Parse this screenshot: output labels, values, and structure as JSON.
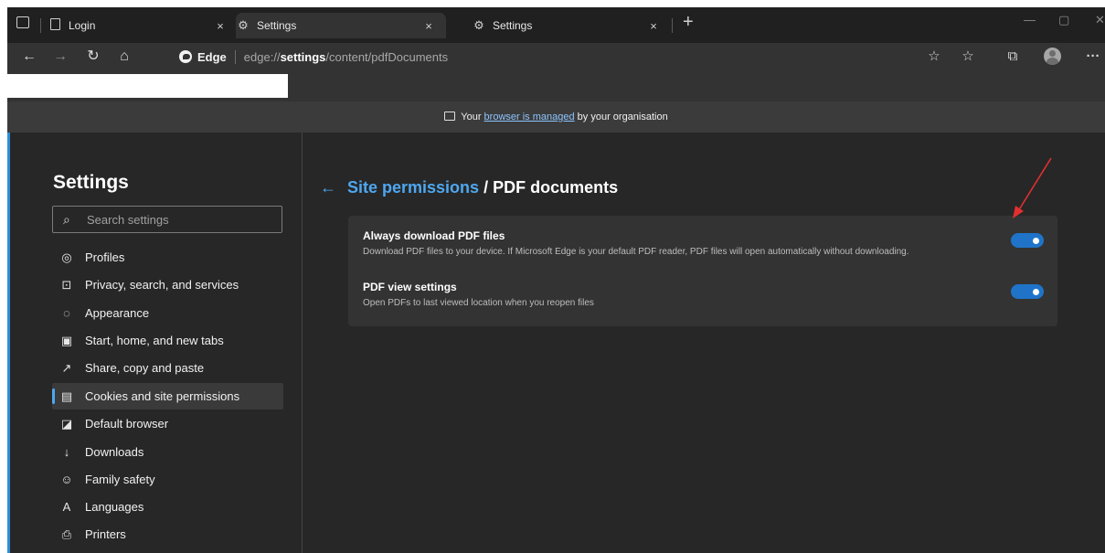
{
  "tabs": [
    {
      "title": "Login",
      "icon": "page-icon",
      "close": "×",
      "active": false
    },
    {
      "title": "Settings",
      "icon": "gear-icon",
      "close": "×",
      "active": true
    },
    {
      "title": "Settings",
      "icon": "gear-icon",
      "close": "×",
      "active": false
    }
  ],
  "new_tab": "+",
  "window_controls": {
    "minimize": "—",
    "maximize": "▢",
    "close": "✕"
  },
  "address_bar": {
    "brand": "Edge",
    "url_prefix": "edge://",
    "url_strong": "settings",
    "url_rest": "/content/pdfDocuments"
  },
  "managed_banner": {
    "prefix": "Your ",
    "link": "browser is managed",
    "suffix": " by your organisation"
  },
  "sidebar": {
    "title": "Settings",
    "search_placeholder": "Search settings",
    "items": [
      {
        "label": "Profiles",
        "icon": "profile-icon"
      },
      {
        "label": "Privacy, search, and services",
        "icon": "lock-icon"
      },
      {
        "label": "Appearance",
        "icon": "palette-icon"
      },
      {
        "label": "Start, home, and new tabs",
        "icon": "start-home-icon"
      },
      {
        "label": "Share, copy and paste",
        "icon": "share-icon"
      },
      {
        "label": "Cookies and site permissions",
        "icon": "cookies-icon",
        "selected": true
      },
      {
        "label": "Default browser",
        "icon": "default-browser-icon"
      },
      {
        "label": "Downloads",
        "icon": "download-icon"
      },
      {
        "label": "Family safety",
        "icon": "family-icon"
      },
      {
        "label": "Languages",
        "icon": "languages-icon"
      },
      {
        "label": "Printers",
        "icon": "printer-icon"
      }
    ]
  },
  "main": {
    "breadcrumb_link": "Site permissions",
    "breadcrumb_sep": "/",
    "breadcrumb_current": "PDF documents",
    "settings": [
      {
        "title": "Always download PDF files",
        "description": "Download PDF files to your device. If Microsoft Edge is your default PDF reader, PDF files will open automatically without downloading.",
        "enabled": true
      },
      {
        "title": "PDF view settings",
        "description": "Open PDFs to last viewed location when you reopen files",
        "enabled": true
      }
    ]
  },
  "colors": {
    "accent": "#4ea7f0",
    "toggle_on": "#1f74c9",
    "annotation_arrow": "#e03030"
  }
}
